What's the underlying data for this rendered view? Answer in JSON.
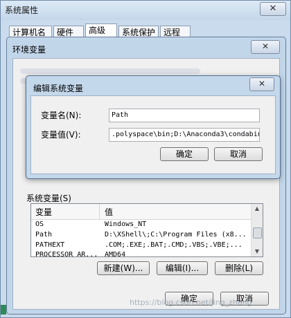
{
  "system_properties": {
    "title": "系统属性",
    "close": "✕",
    "tabs": [
      "计算机名",
      "硬件",
      "高级",
      "系统保护",
      "远程"
    ]
  },
  "env_window": {
    "title": "环境变量",
    "close": "✕",
    "system_vars_label": "系统变量(S)",
    "columns": [
      "变量",
      "值"
    ],
    "rows": [
      {
        "name": "OS",
        "value": "Windows_NT"
      },
      {
        "name": "Path",
        "value": "D:\\XShell\\;C:\\Program Files (x8..."
      },
      {
        "name": "PATHEXT",
        "value": ".COM;.EXE;.BAT;.CMD;.VBS;.VBE;..."
      },
      {
        "name": "PROCESSOR_AR...",
        "value": "AMD64"
      }
    ],
    "buttons": {
      "new": "新建(W)...",
      "edit": "编辑(I)...",
      "delete": "删除(L)",
      "ok": "确定",
      "cancel": "取消"
    }
  },
  "edit_dialog": {
    "title": "编辑系统变量",
    "close": "✕",
    "name_label": "变量名(N):",
    "value_label": "变量值(V):",
    "name_value": "Path",
    "value_value": ".polyspace\\bin;D:\\Anaconda3\\condabin",
    "ok": "确定",
    "cancel": "取消"
  },
  "watermark": "https://blog.csdn.net/jing_zhong"
}
